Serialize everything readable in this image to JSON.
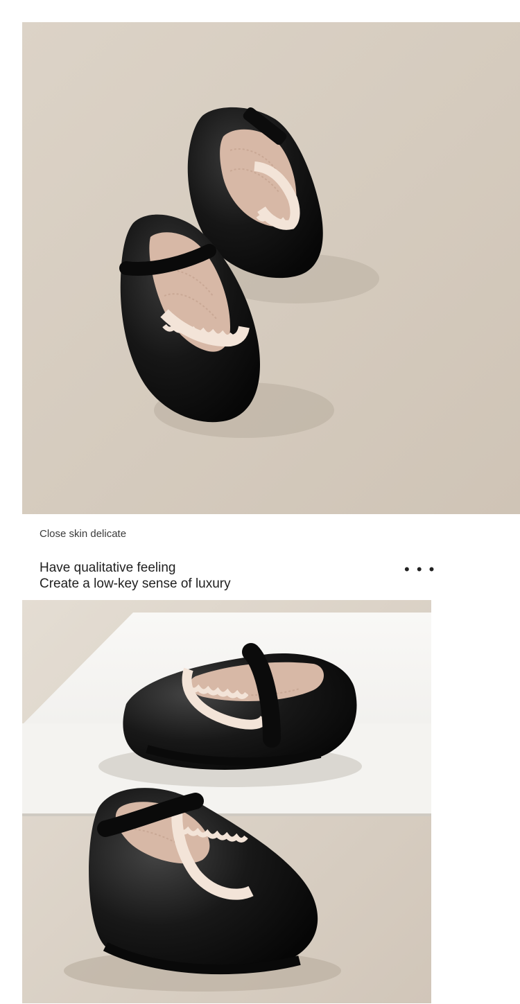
{
  "caption": {
    "small_text": "Close skin delicate",
    "headline_line1": "Have qualitative feeling",
    "headline_line2": "Create a low-key sense of luxury",
    "more_dots": "• • •"
  },
  "colors": {
    "background_top": "#d6ccbf",
    "background_bottom": "#dcd3c8",
    "shoe_leather": "#141414",
    "shoe_lining": "#d7b8a6",
    "scallop_trim": "#f3e4d8"
  },
  "images": {
    "top_photo": "two-black-mary-jane-shoes-top-view",
    "bottom_photo": "two-black-mary-jane-shoes-on-white-block"
  }
}
